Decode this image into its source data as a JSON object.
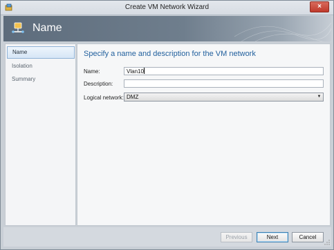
{
  "window": {
    "title": "Create VM Network Wizard",
    "close_label": "×"
  },
  "header": {
    "title": "Name"
  },
  "nav": {
    "items": [
      {
        "label": "Name",
        "active": true
      },
      {
        "label": "Isolation",
        "active": false
      },
      {
        "label": "Summary",
        "active": false
      }
    ]
  },
  "main": {
    "heading": "Specify a name and description for the VM network",
    "name_label": "Name:",
    "name_value": "Vlan10",
    "description_label": "Description:",
    "description_value": "",
    "logical_network_label": "Logical network:",
    "logical_network_value": "DMZ"
  },
  "footer": {
    "previous_label": "Previous",
    "next_label": "Next",
    "cancel_label": "Cancel"
  },
  "colors": {
    "heading_blue": "#1f5e9c",
    "close_red": "#c0392b",
    "banner_slate": "#5d6c7c"
  }
}
